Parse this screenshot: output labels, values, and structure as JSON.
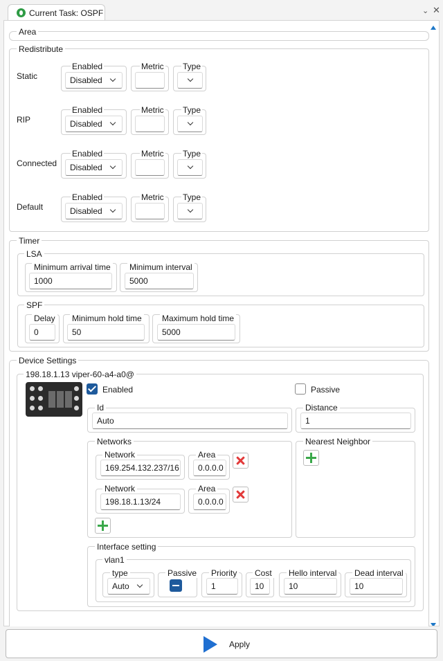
{
  "tab": {
    "title": "Current Task: OSPF"
  },
  "area": {
    "legend": "Area"
  },
  "redistribute": {
    "legend": "Redistribute",
    "enabled_label": "Enabled",
    "metric_label": "Metric",
    "type_label": "Type",
    "rows": [
      {
        "name": "Static",
        "enabled": "Disabled",
        "metric": "",
        "type": ""
      },
      {
        "name": "RIP",
        "enabled": "Disabled",
        "metric": "",
        "type": ""
      },
      {
        "name": "Connected",
        "enabled": "Disabled",
        "metric": "",
        "type": ""
      },
      {
        "name": "Default",
        "enabled": "Disabled",
        "metric": "",
        "type": ""
      }
    ]
  },
  "timer": {
    "legend": "Timer",
    "lsa": {
      "legend": "LSA",
      "min_arrival_label": "Minimum arrival time",
      "min_arrival": "1000",
      "min_interval_label": "Minimum interval",
      "min_interval": "5000"
    },
    "spf": {
      "legend": "SPF",
      "delay_label": "Delay",
      "delay": "0",
      "min_hold_label": "Minimum hold time",
      "min_hold": "50",
      "max_hold_label": "Maximum hold time",
      "max_hold": "5000"
    }
  },
  "device_settings": {
    "legend": "Device Settings",
    "device": {
      "legend": "198.18.1.13 viper-60-a4-a0@",
      "enabled_label": "Enabled",
      "enabled": true,
      "passive_label": "Passive",
      "passive": false,
      "id_label": "Id",
      "id": "Auto",
      "distance_label": "Distance",
      "distance": "1",
      "networks": {
        "legend": "Networks",
        "network_label": "Network",
        "area_label": "Area",
        "rows": [
          {
            "network": "169.254.132.237/16",
            "area": "0.0.0.0"
          },
          {
            "network": "198.18.1.13/24",
            "area": "0.0.0.0"
          }
        ]
      },
      "nearest_neighbor": {
        "legend": "Nearest Neighbor"
      },
      "interface": {
        "legend": "Interface setting",
        "vlan": {
          "legend": "vlan1",
          "type_label": "type",
          "type": "Auto",
          "passive_label": "Passive",
          "priority_label": "Priority",
          "priority": "1",
          "cost_label": "Cost",
          "cost": "10",
          "hello_label": "Hello interval",
          "hello": "10",
          "dead_label": "Dead interval",
          "dead": "10"
        }
      }
    }
  },
  "apply": {
    "label": "Apply"
  },
  "colors": {
    "accent": "#1e5a9c",
    "apply_icon": "#1f6fd1",
    "remove": "#e23a3a",
    "add": "#3aa84a"
  }
}
